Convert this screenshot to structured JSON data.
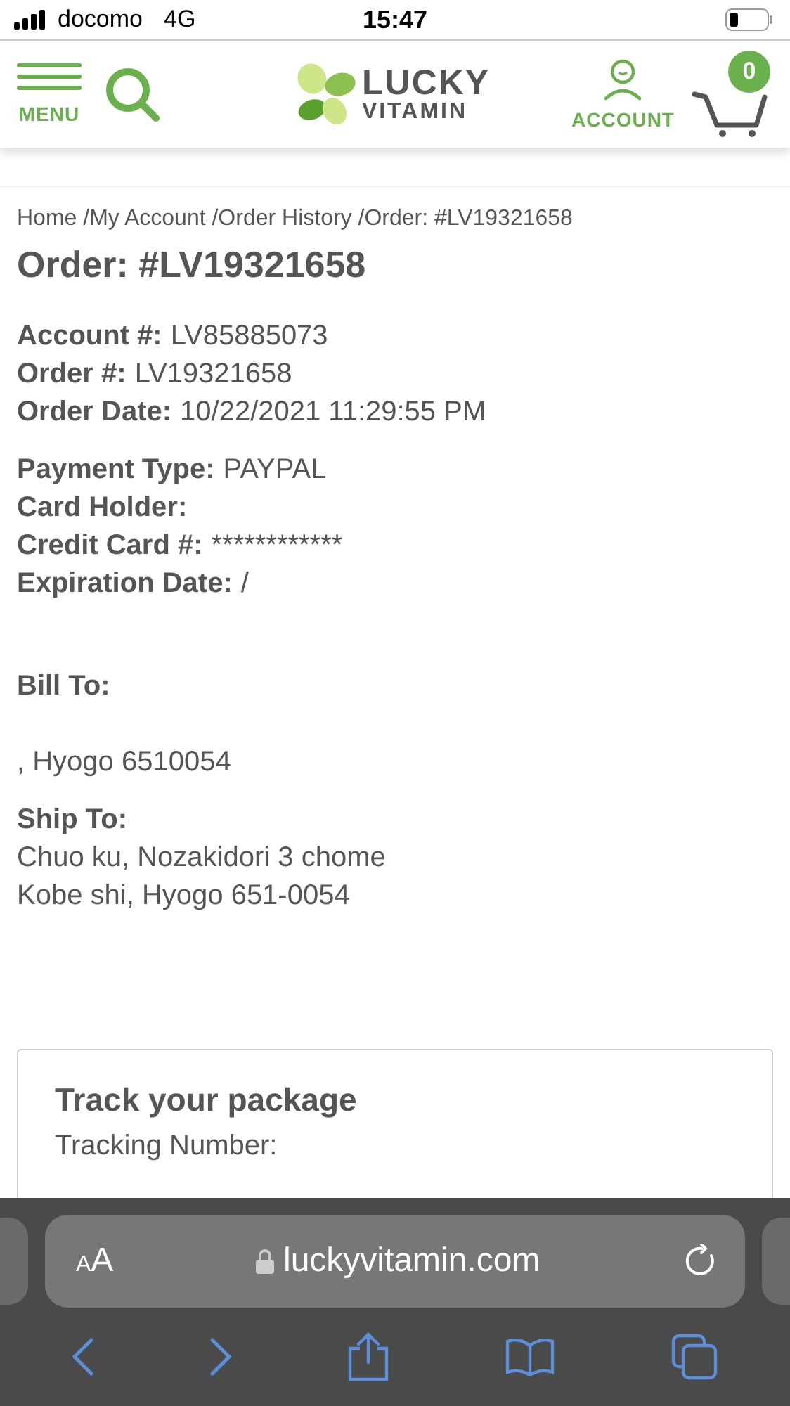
{
  "status_bar": {
    "carrier": "docomo",
    "network": "4G",
    "time": "15:47"
  },
  "header": {
    "menu_label": "MENU",
    "logo_top": "LUCKY",
    "logo_bottom": "VITAMIN",
    "account_label": "ACCOUNT",
    "cart_count": "0"
  },
  "breadcrumb": [
    "Home /",
    "My Account /",
    "Order History /",
    "Order: #LV19321658"
  ],
  "title": "Order: #LV19321658",
  "field_groups": [
    [
      {
        "label": "Account #:",
        "value": "LV85885073"
      },
      {
        "label": "Order #:",
        "value": "LV19321658"
      },
      {
        "label": "Order Date:",
        "value": "10/22/2021 11:29:55 PM"
      }
    ],
    [
      {
        "label": "Payment Type:",
        "value": "PAYPAL"
      },
      {
        "label": "Card Holder:"
      },
      {
        "label": "Credit Card #:",
        "value": "************"
      },
      {
        "label": "Expiration Date:",
        "value": "/"
      }
    ]
  ],
  "bill_to": {
    "heading": "Bill To:",
    "lines": [
      ", Hyogo 6510054"
    ]
  },
  "ship_to": {
    "heading": "Ship To:",
    "lines": [
      "Chuo ku, Nozakidori 3 chome",
      "Kobe shi, Hyogo 651-0054"
    ]
  },
  "track": {
    "title": "Track your package",
    "label": "Tracking Number:"
  },
  "browser": {
    "text_size_small": "A",
    "text_size_large": "A",
    "url": "luckyvitamin.com"
  }
}
